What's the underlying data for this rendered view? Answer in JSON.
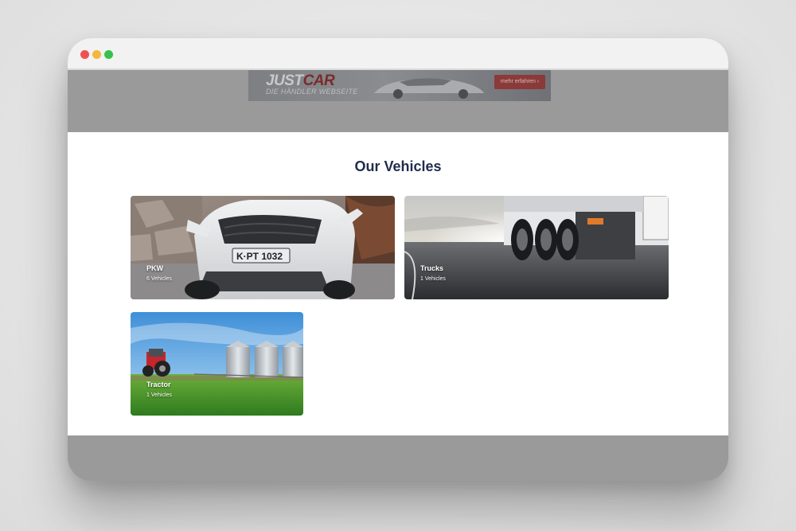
{
  "banner": {
    "logo_part1": "JUST",
    "logo_part2": "CAR",
    "tagline": "DIE HÄNDLER WEBSEITE",
    "button_label": "mehr erfahren ›"
  },
  "section": {
    "title": "Our Vehicles"
  },
  "categories": [
    {
      "title": "PKW",
      "count": "6 Vehicles"
    },
    {
      "title": "Trucks",
      "count": "1 Vehicles"
    },
    {
      "title": "Tractor",
      "count": "1 Vehicles"
    }
  ],
  "colors": {
    "heading": "#1f2c4c",
    "overlay": "#9a9a9a",
    "dot_red": "#ef5350",
    "dot_yellow": "#f4b63f",
    "dot_green": "#36c24a"
  }
}
